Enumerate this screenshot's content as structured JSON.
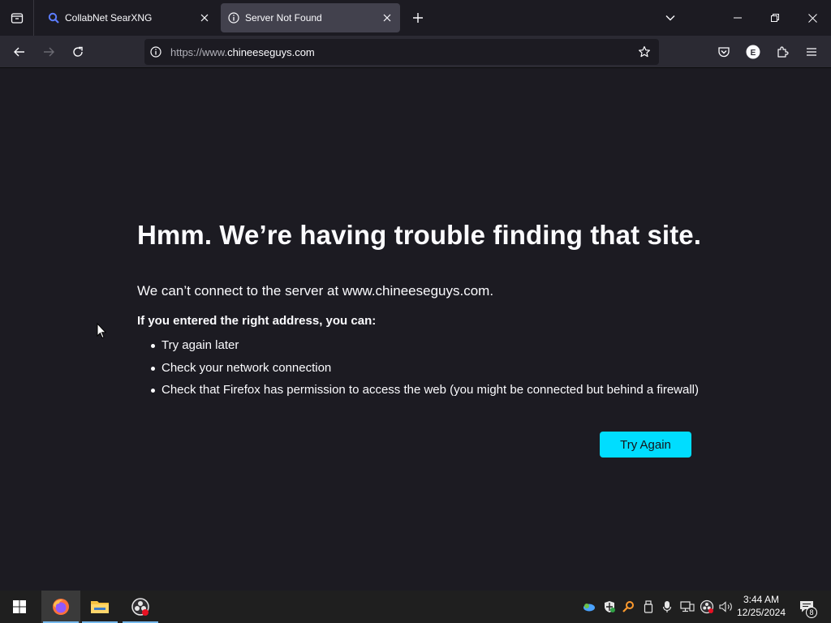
{
  "browser": {
    "tabs": [
      {
        "label": "CollabNet SearXNG",
        "icon": "search-icon",
        "active": false
      },
      {
        "label": "Server Not Found",
        "icon": "info-icon",
        "active": true
      }
    ],
    "url_prefix": "https://www.",
    "url_host": "chineeseguys.com"
  },
  "page": {
    "title": "Hmm. We’re having trouble finding that site.",
    "lead": "We can’t connect to the server at www.chineeseguys.com.",
    "sub": "If you entered the right address, you can:",
    "suggestions": [
      "Try again later",
      "Check your network connection",
      "Check that Firefox has permission to access the web (you might be connected but behind a firewall)"
    ],
    "try_again_label": "Try Again"
  },
  "taskbar": {
    "time": "3:44 AM",
    "date": "12/25/2024",
    "notification_count": "8"
  },
  "colors": {
    "page_bg": "#1c1b22",
    "toolbar_bg": "#2b2a33",
    "accent": "#00ddff",
    "text": "#fbfbfe"
  }
}
